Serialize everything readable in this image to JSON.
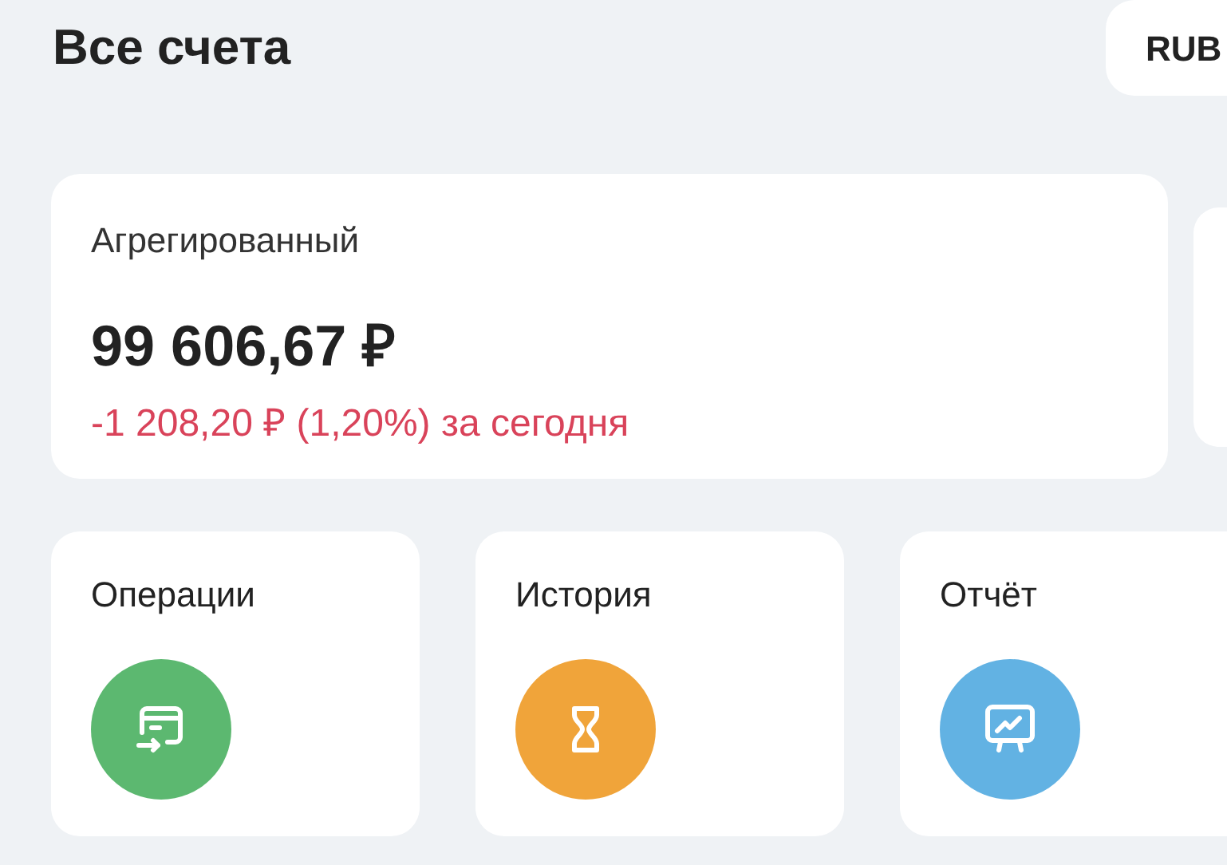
{
  "header": {
    "title": "Все счета",
    "currency_button": "RUB"
  },
  "account_card": {
    "name": "Агрегированный",
    "balance": "99 606,67 ₽",
    "change": "-1 208,20 ₽ (1,20%) за сегодня"
  },
  "tiles": [
    {
      "label": "Операции",
      "kind": "operations",
      "color": "#5cb870"
    },
    {
      "label": "История",
      "kind": "history",
      "color": "#f0a43a"
    },
    {
      "label": "Отчёт",
      "kind": "report",
      "color": "#62b2e3"
    }
  ]
}
